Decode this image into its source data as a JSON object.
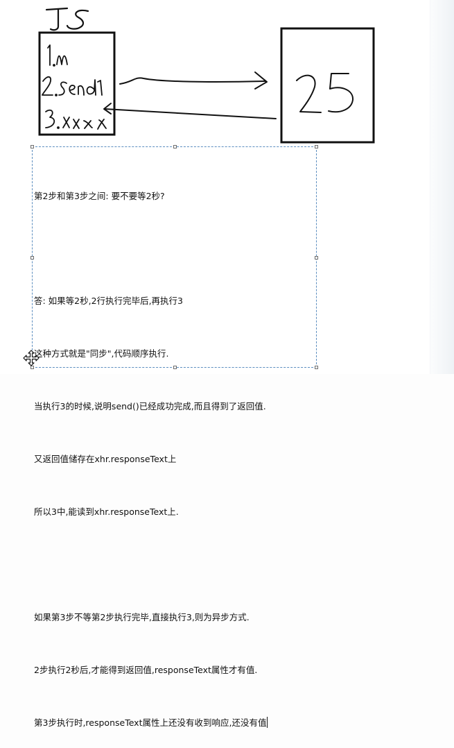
{
  "sketch": {
    "top_label": "JS",
    "left_box": {
      "lines": [
        "1.new",
        "2.send",
        "3.xxx"
      ]
    },
    "right_box": {
      "label": "25"
    }
  },
  "textbox": {
    "lines": [
      "第2步和第3步之间: 要不要等2秒?",
      "",
      "答: 如果等2秒,2行执行完毕后,再执行3",
      "这种方式就是\"同步\",代码顺序执行.",
      "当执行3的时候,说明send()已经成功完成,而且得到了返回值.",
      "又返回值储存在xhr.responseText上",
      "所以3中,能读到xhr.responseText上.",
      "",
      "如果第3步不等第2步执行完毕,直接执行3,则为异步方式.",
      "2步执行2秒后,才能得到返回值,responseText属性才有值.",
      "第3步执行时,responseText属性上还没有收到响应,还没有值"
    ]
  }
}
